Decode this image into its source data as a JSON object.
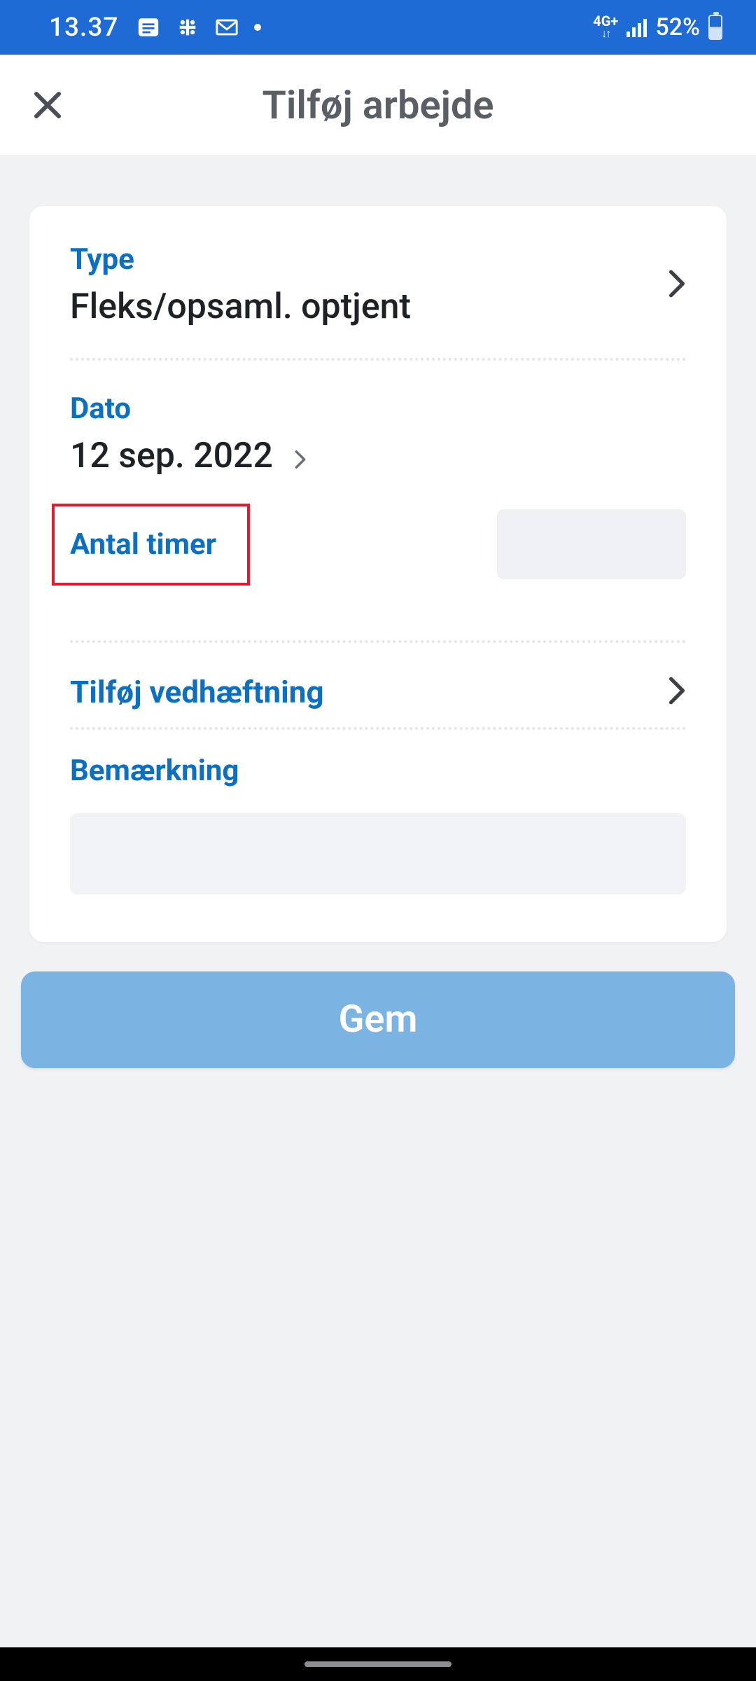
{
  "statusbar": {
    "time": "13.37",
    "network_label": "4G+",
    "battery_text": "52%"
  },
  "header": {
    "title": "Tilføj arbejde"
  },
  "form": {
    "type_label": "Type",
    "type_value": "Fleks/opsaml. optjent",
    "date_label": "Dato",
    "date_value": "12 sep. 2022",
    "hours_label": "Antal timer",
    "hours_value": "",
    "attachment_label": "Tilføj vedhæftning",
    "remark_label": "Bemærkning",
    "remark_value": ""
  },
  "actions": {
    "save_label": "Gem"
  }
}
